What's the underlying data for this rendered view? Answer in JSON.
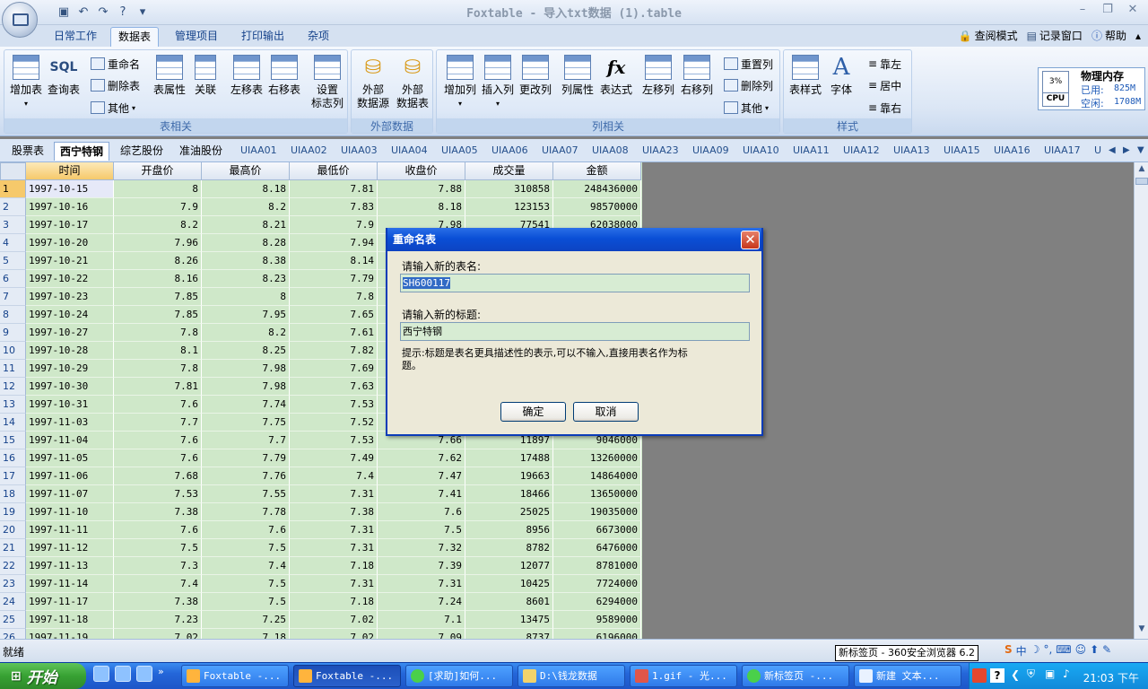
{
  "window": {
    "title": "Foxtable - 导入txt数据 (1).table"
  },
  "ribbon_tabs": [
    "日常工作",
    "数据表",
    "管理项目",
    "打印输出",
    "杂项"
  ],
  "right_links": [
    "查阅模式",
    "记录窗口",
    "帮助"
  ],
  "groups": {
    "table": {
      "label": "表相关",
      "big": [
        "增加表",
        "查询表",
        "表属性",
        "关联",
        "左移表",
        "右移表",
        "设置\n标志列"
      ],
      "small": [
        "重命名",
        "删除表",
        "其他"
      ]
    },
    "external": {
      "label": "外部数据",
      "big": [
        "外部\n数据源",
        "外部\n数据表"
      ]
    },
    "column": {
      "label": "列相关",
      "big": [
        "增加列",
        "插入列",
        "更改列",
        "列属性",
        "表达式",
        "左移列",
        "右移列"
      ],
      "small": [
        "重置列",
        "删除列",
        "其他"
      ]
    },
    "style": {
      "label": "样式",
      "big": [
        "表样式",
        "字体"
      ],
      "small": [
        "靠左",
        "居中",
        "靠右"
      ]
    }
  },
  "memory": {
    "title": "物理内存",
    "cpu_label": "CPU",
    "cpu_value": "3%",
    "used_label": "已用:",
    "used_value": "825M",
    "free_label": "空闲:",
    "free_value": "1708M"
  },
  "sheet_tabs": [
    "股票表",
    "西宁特钢",
    "综艺股份",
    "准油股份",
    "UIAA01",
    "UIAA02",
    "UIAA03",
    "UIAA04",
    "UIAA05",
    "UIAA06",
    "UIAA07",
    "UIAA08",
    "UIAA23",
    "UIAA09",
    "UIAA10",
    "UIAA11",
    "UIAA12",
    "UIAA13",
    "UIAA15",
    "UIAA16",
    "UIAA17",
    "U"
  ],
  "columns": [
    "时间",
    "开盘价",
    "最高价",
    "最低价",
    "收盘价",
    "成交量",
    "金额"
  ],
  "rows": [
    [
      "1",
      "1997-10-15",
      "8",
      "8.18",
      "7.81",
      "7.88",
      "310858",
      "248436000"
    ],
    [
      "2",
      "1997-10-16",
      "7.9",
      "8.2",
      "7.83",
      "8.18",
      "123153",
      "98570000"
    ],
    [
      "3",
      "1997-10-17",
      "8.2",
      "8.21",
      "7.9",
      "7.98",
      "77541",
      "62038000"
    ],
    [
      "4",
      "1997-10-20",
      "7.96",
      "8.28",
      "7.94",
      "",
      "",
      ""
    ],
    [
      "5",
      "1997-10-21",
      "8.26",
      "8.38",
      "8.14",
      "",
      "",
      ""
    ],
    [
      "6",
      "1997-10-22",
      "8.16",
      "8.23",
      "7.79",
      "",
      "",
      ""
    ],
    [
      "7",
      "1997-10-23",
      "7.85",
      "8",
      "7.8",
      "",
      "",
      ""
    ],
    [
      "8",
      "1997-10-24",
      "7.85",
      "7.95",
      "7.65",
      "",
      "",
      ""
    ],
    [
      "9",
      "1997-10-27",
      "7.8",
      "8.2",
      "7.61",
      "",
      "",
      ""
    ],
    [
      "10",
      "1997-10-28",
      "8.1",
      "8.25",
      "7.82",
      "",
      "",
      ""
    ],
    [
      "11",
      "1997-10-29",
      "7.8",
      "7.98",
      "7.69",
      "",
      "",
      ""
    ],
    [
      "12",
      "1997-10-30",
      "7.81",
      "7.98",
      "7.63",
      "",
      "",
      ""
    ],
    [
      "13",
      "1997-10-31",
      "7.6",
      "7.74",
      "7.53",
      "",
      "",
      ""
    ],
    [
      "14",
      "1997-11-03",
      "7.7",
      "7.75",
      "7.52",
      "",
      "",
      ""
    ],
    [
      "15",
      "1997-11-04",
      "7.6",
      "7.7",
      "7.53",
      "7.66",
      "11897",
      "9046000"
    ],
    [
      "16",
      "1997-11-05",
      "7.6",
      "7.79",
      "7.49",
      "7.62",
      "17488",
      "13260000"
    ],
    [
      "17",
      "1997-11-06",
      "7.68",
      "7.76",
      "7.4",
      "7.47",
      "19663",
      "14864000"
    ],
    [
      "18",
      "1997-11-07",
      "7.53",
      "7.55",
      "7.31",
      "7.41",
      "18466",
      "13650000"
    ],
    [
      "19",
      "1997-11-10",
      "7.38",
      "7.78",
      "7.38",
      "7.6",
      "25025",
      "19035000"
    ],
    [
      "20",
      "1997-11-11",
      "7.6",
      "7.6",
      "7.31",
      "7.5",
      "8956",
      "6673000"
    ],
    [
      "21",
      "1997-11-12",
      "7.5",
      "7.5",
      "7.31",
      "7.32",
      "8782",
      "6476000"
    ],
    [
      "22",
      "1997-11-13",
      "7.3",
      "7.4",
      "7.18",
      "7.39",
      "12077",
      "8781000"
    ],
    [
      "23",
      "1997-11-14",
      "7.4",
      "7.5",
      "7.31",
      "7.31",
      "10425",
      "7724000"
    ],
    [
      "24",
      "1997-11-17",
      "7.38",
      "7.5",
      "7.18",
      "7.24",
      "8601",
      "6294000"
    ],
    [
      "25",
      "1997-11-18",
      "7.23",
      "7.25",
      "7.02",
      "7.1",
      "13475",
      "9589000"
    ],
    [
      "26",
      "1997-11-19",
      "7.02",
      "7.18",
      "7.02",
      "7.09",
      "8737",
      "6196000"
    ]
  ],
  "dialog": {
    "title": "重命名表",
    "name_label": "请输入新的表名:",
    "name_value": "SH600117",
    "caption_label": "请输入新的标题:",
    "caption_value": "西宁特钢",
    "hint_line1": "提示:标题是表名更具描述性的表示,可以不输入,直接用表名作为标",
    "hint_line2": "题。",
    "ok": "确定",
    "cancel": "取消"
  },
  "status": {
    "text": "就绪",
    "browser_tip": "新标签页 - 360安全浏览器 6.2"
  },
  "taskbar": {
    "start": "开始",
    "tasks": [
      "Foxtable -...",
      "Foxtable -...",
      "[求助]如何...",
      "D:\\钱龙数据",
      "1.gif - 光...",
      "新标签页 -...",
      "新建 文本..."
    ],
    "clock": "21:03 下午",
    "ime": "中"
  },
  "colors": {
    "grid_bg": "#cfe8c9",
    "dialog_title": "#0a4fd6",
    "ribbon_bg": "#dbe6f5"
  }
}
